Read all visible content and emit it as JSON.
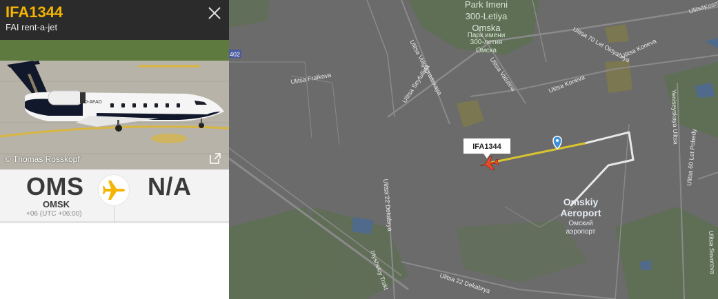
{
  "flight": {
    "callsign": "IFA1344",
    "airline": "FAI rent-a-jet"
  },
  "photo": {
    "credit": "© Thomas Rosskopf",
    "registration": "D-AFAD"
  },
  "route": {
    "origin_code": "OMS",
    "origin_city": "OMSK",
    "origin_tz": "+06 (UTC +06:00)",
    "destination_code": "N/A"
  },
  "map": {
    "aircraft_label": "IFA1344",
    "airport_name_line1": "Omskiy",
    "airport_name_line2": "Aeroport",
    "airport_name_ru1": "Омский",
    "airport_name_ru2": "аэропорт",
    "park_line1": "Park Imeni",
    "park_line2": "300-Letiya",
    "park_line3": "Omska",
    "park_ru1": "Парк имени",
    "park_ru2": "300-летия",
    "park_ru3": "Омска",
    "road_badge": "402",
    "streets": {
      "volgogradskaya": "Ulitsa Volgogradskaya",
      "vatutina": "Ulitsa Vatutina",
      "seyfullina": "Ulitsa Seyfullina",
      "fralkova": "Ulitsa Fralkova",
      "let_oktyabrya": "Ulitsa 70 Let Oktyabrya",
      "koneva_upper": "Ulitsa Koneva",
      "koneva": "Ulitsa Koneva",
      "dekabrya22_v": "Ulitsa 22 Dekabrya",
      "dekabrya22_h": "Ulitsa 22 Dekabrya",
      "irtyshskiy": "Irtyshskiy Trakt",
      "yeniseyskaya": "Yeniseyskaya Ulitsa",
      "let_pobedy": "Ulitsa 60 Let Pobedy",
      "ulitsa": "Ulitsa",
      "suvorova": "Ulitsa Suvorova",
      "kosm": "Kosm"
    }
  },
  "colors": {
    "accent": "#f5b400",
    "header_bg": "#2b2b2b",
    "trail_flown": "#d9c430",
    "trail_old": "#e8e8e8",
    "map_bg": "#6b6b6b"
  }
}
